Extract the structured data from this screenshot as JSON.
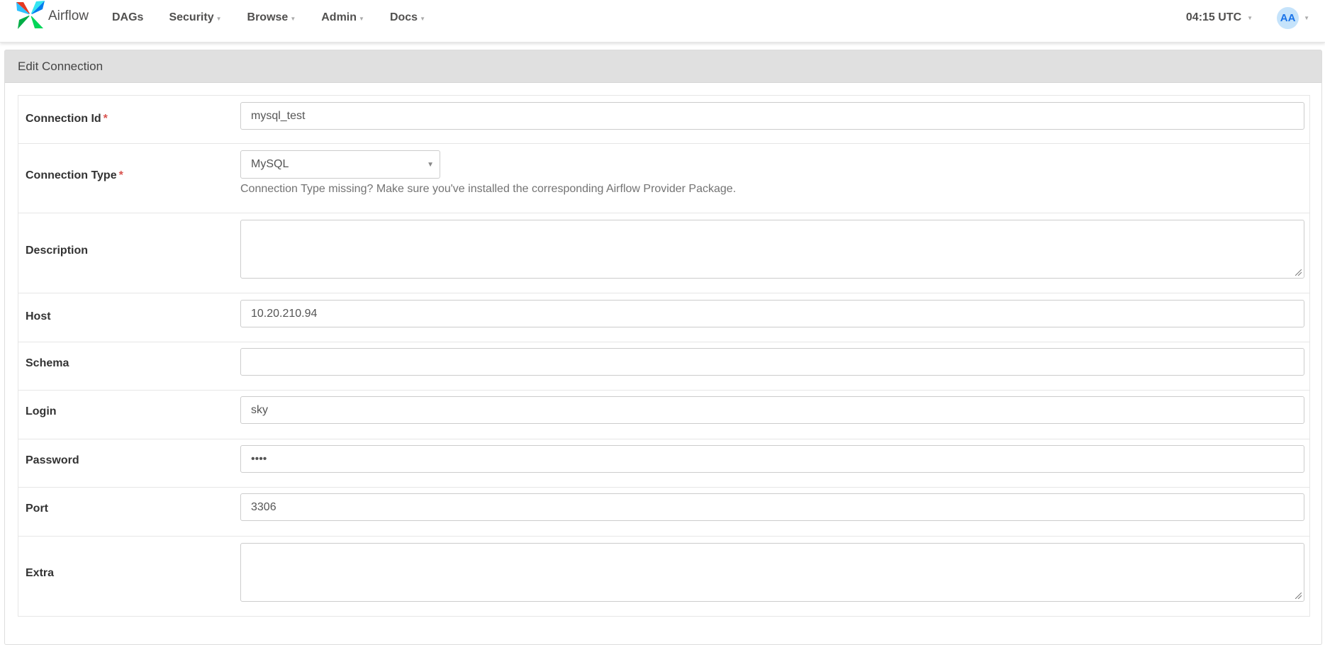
{
  "brand": {
    "name": "Airflow"
  },
  "nav": {
    "items": [
      {
        "label": "DAGs",
        "has_dropdown": false
      },
      {
        "label": "Security",
        "has_dropdown": true
      },
      {
        "label": "Browse",
        "has_dropdown": true
      },
      {
        "label": "Admin",
        "has_dropdown": true
      },
      {
        "label": "Docs",
        "has_dropdown": true
      }
    ],
    "time": "04:15 UTC",
    "user_initials": "AA"
  },
  "page": {
    "title": "Edit Connection"
  },
  "form": {
    "conn_id": {
      "label": "Connection Id",
      "required_mark": "*",
      "value": "mysql_test"
    },
    "conn_type": {
      "label": "Connection Type",
      "required_mark": "*",
      "value": "MySQL",
      "help": "Connection Type missing? Make sure you've installed the corresponding Airflow Provider Package."
    },
    "description": {
      "label": "Description",
      "value": ""
    },
    "host": {
      "label": "Host",
      "value": "10.20.210.94"
    },
    "schema": {
      "label": "Schema",
      "value": ""
    },
    "login": {
      "label": "Login",
      "value": "sky"
    },
    "password": {
      "label": "Password",
      "value": "••••"
    },
    "port": {
      "label": "Port",
      "value": "3306"
    },
    "extra": {
      "label": "Extra",
      "value": ""
    }
  },
  "colors": {
    "accent": "#1a73e8",
    "required": "#d9534f",
    "panel_heading_bg": "#e0e0e0",
    "avatar_bg": "#c5e3fb"
  }
}
